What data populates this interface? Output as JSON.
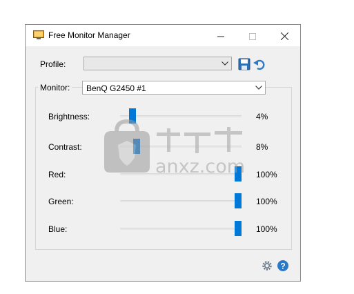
{
  "window": {
    "title": "Free Monitor Manager"
  },
  "profile": {
    "label": "Profile:",
    "value": ""
  },
  "monitor": {
    "label": "Monitor:",
    "value": "BenQ G2450 #1"
  },
  "sliders": [
    {
      "label": "Brightness:",
      "value_text": "4%",
      "level": 0.04
    },
    {
      "label": "Contrast:",
      "value_text": "8%",
      "level": 0.08
    },
    {
      "label": "Red:",
      "value_text": "100%",
      "level": 1.0
    },
    {
      "label": "Green:",
      "value_text": "100%",
      "level": 1.0
    },
    {
      "label": "Blue:",
      "value_text": "100%",
      "level": 1.0
    }
  ],
  "watermark": {
    "text": "anxz.com"
  },
  "icons": [
    "app-monitor-icon",
    "minimize-icon",
    "maximize-icon",
    "close-icon",
    "chevron-down-icon",
    "save-icon",
    "undo-icon",
    "gear-icon",
    "help-icon"
  ],
  "colors": {
    "accent": "#0078d7",
    "window_bg": "#f0f0f0"
  }
}
